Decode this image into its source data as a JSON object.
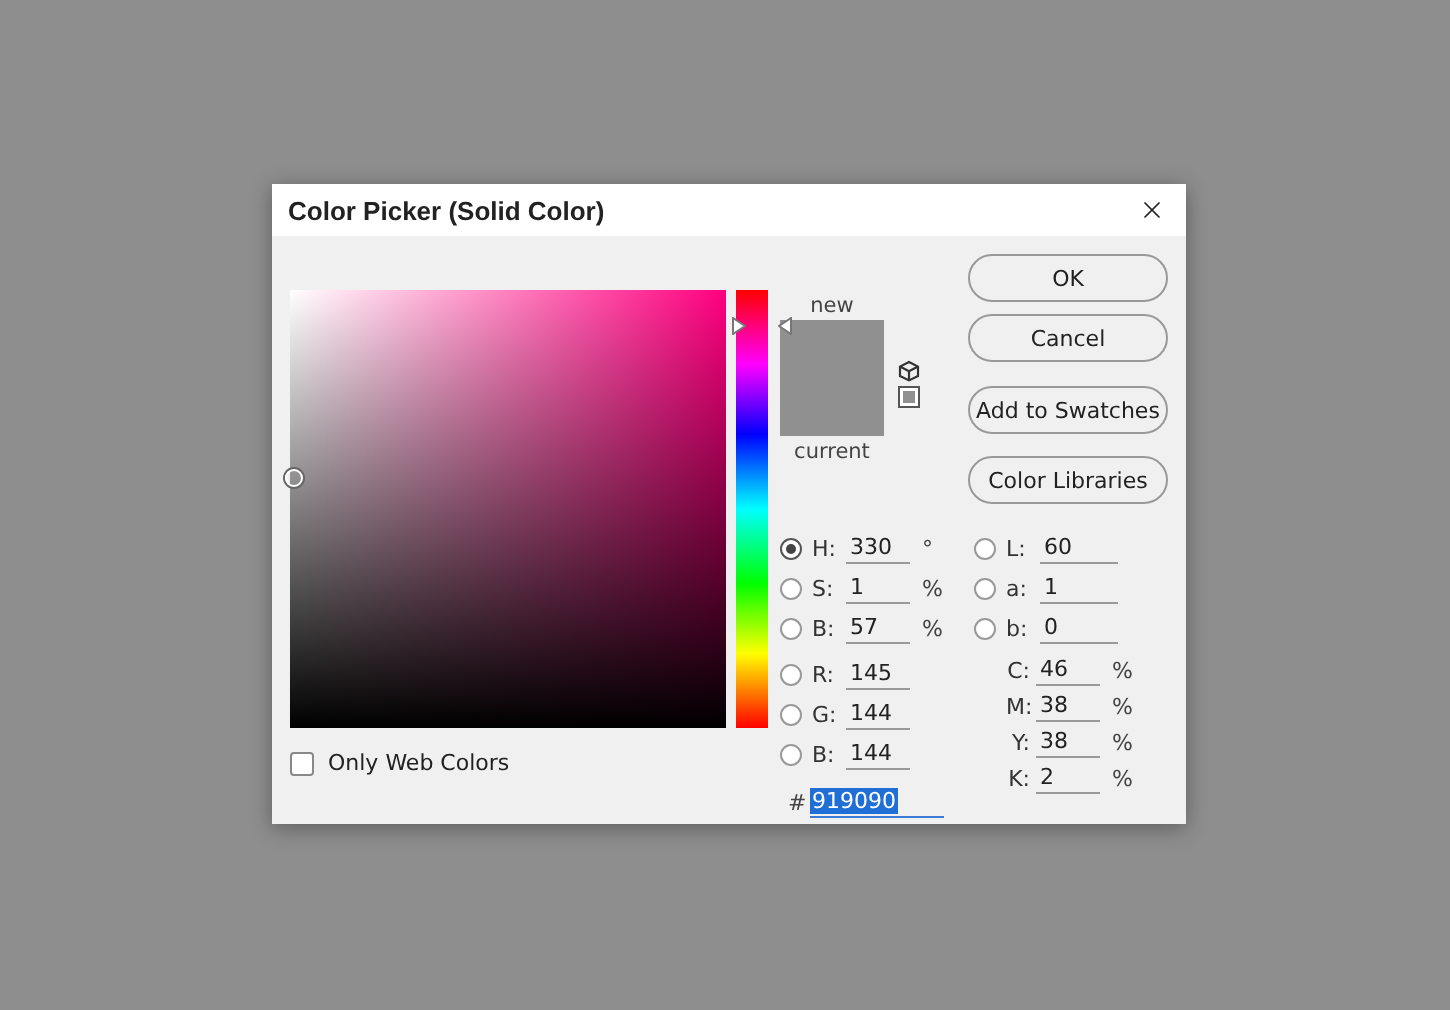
{
  "title": "Color Picker (Solid Color)",
  "preview": {
    "new_label": "new",
    "current_label": "current"
  },
  "buttons": [
    {
      "label": "OK"
    },
    {
      "label": "Cancel"
    },
    {
      "label": "Add to Swatches"
    },
    {
      "label": "Color Libraries"
    }
  ],
  "only_web_colors": {
    "label": "Only Web Colors",
    "checked": false
  },
  "fields_left": [
    {
      "kind": "radio",
      "label": "H:",
      "value": "330",
      "unit": "°",
      "selected": true
    },
    {
      "kind": "radio",
      "label": "S:",
      "value": "1",
      "unit": "%",
      "selected": false
    },
    {
      "kind": "radio",
      "label": "B:",
      "value": "57",
      "unit": "%",
      "selected": false
    },
    {
      "kind": "radio",
      "label": "R:",
      "value": "145",
      "selected": false
    },
    {
      "kind": "radio",
      "label": "G:",
      "value": "144",
      "selected": false
    },
    {
      "kind": "radio",
      "label": "B:",
      "value": "144",
      "selected": false
    }
  ],
  "fields_right": [
    {
      "kind": "radio",
      "label": "L:",
      "value": "60",
      "selected": false
    },
    {
      "kind": "radio",
      "label": "a:",
      "value": "1",
      "selected": false
    },
    {
      "kind": "radio",
      "label": "b:",
      "value": "0",
      "selected": false
    },
    {
      "kind": "plain",
      "label": "C:",
      "value": "46",
      "unit": "%"
    },
    {
      "kind": "plain",
      "label": "M:",
      "value": "38",
      "unit": "%"
    },
    {
      "kind": "plain",
      "label": "Y:",
      "value": "38",
      "unit": "%"
    },
    {
      "kind": "plain",
      "label": "K:",
      "value": "2",
      "unit": "%"
    }
  ],
  "hex": {
    "label": "#",
    "value": "919090",
    "text_selected": true
  }
}
